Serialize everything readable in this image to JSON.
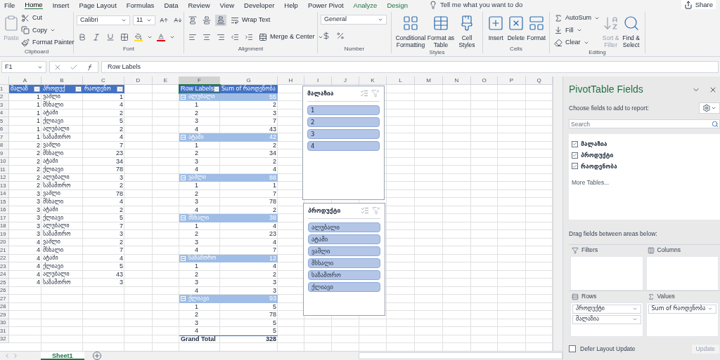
{
  "menu_tabs": [
    {
      "label": "File",
      "selected": false,
      "contextual": false
    },
    {
      "label": "Home",
      "selected": true,
      "contextual": false
    },
    {
      "label": "Insert",
      "selected": false,
      "contextual": false
    },
    {
      "label": "Page Layout",
      "selected": false,
      "contextual": false
    },
    {
      "label": "Formulas",
      "selected": false,
      "contextual": false
    },
    {
      "label": "Data",
      "selected": false,
      "contextual": false
    },
    {
      "label": "Review",
      "selected": false,
      "contextual": false
    },
    {
      "label": "View",
      "selected": false,
      "contextual": false
    },
    {
      "label": "Developer",
      "selected": false,
      "contextual": false
    },
    {
      "label": "Help",
      "selected": false,
      "contextual": false
    },
    {
      "label": "Power Pivot",
      "selected": false,
      "contextual": false
    },
    {
      "label": "Analyze",
      "selected": false,
      "contextual": true
    },
    {
      "label": "Design",
      "selected": false,
      "contextual": true
    }
  ],
  "tell_me": "Tell me what you want to do",
  "share": "Share",
  "ribbon": {
    "clipboard": {
      "label": "Clipboard",
      "paste": {
        "label": "Paste",
        "disabled": true
      },
      "cut": "Cut",
      "copy": "Copy",
      "format_painter": "Format Painter"
    },
    "font": {
      "label": "Font",
      "font_name": "Calibri",
      "font_size": "11"
    },
    "alignment": {
      "label": "Alignment",
      "wrap_text": "Wrap Text",
      "merge_center": "Merge & Center"
    },
    "number": {
      "label": "Number",
      "format": "General"
    },
    "styles": {
      "label": "Styles",
      "buttons": [
        "Conditional Formatting",
        "Format as Table",
        "Cell Styles"
      ]
    },
    "cells": {
      "label": "Cells",
      "buttons": [
        "Insert",
        "Delete",
        "Format"
      ]
    },
    "editing": {
      "label": "Editing",
      "autosum": "AutoSum",
      "fill": "Fill",
      "clear": "Clear",
      "sort_filter": {
        "label": "Sort & Filter",
        "disabled": true
      },
      "find_select": "Find & Select"
    }
  },
  "formula_bar": {
    "name_box": "F1",
    "content": "Row Labels"
  },
  "columns": [
    "A",
    "B",
    "C",
    "D",
    "E",
    "F",
    "G",
    "H",
    "I",
    "J",
    "K",
    "L",
    "M",
    "N",
    "O",
    "P",
    "Q"
  ],
  "row_numbers": [
    "1",
    "2",
    "3",
    "4",
    "5",
    "6",
    "7",
    "8",
    "9",
    "10",
    "11",
    "12",
    "13",
    "14",
    "15",
    "16",
    "17",
    "18",
    "19",
    "20",
    "21",
    "22",
    "23",
    "24",
    "25",
    "26",
    "27",
    "28",
    "29",
    "30",
    "31",
    "32"
  ],
  "source_table": {
    "headers": [
      "მალაზ",
      "პროდუქ",
      "რაოდენო"
    ],
    "rows": [
      [
        "1",
        "ვაშლი",
        "1"
      ],
      [
        "1",
        "მსხალი",
        "4"
      ],
      [
        "1",
        "ატამი",
        "2"
      ],
      [
        "1",
        "ქლიავი",
        "5"
      ],
      [
        "1",
        "ალუბალი",
        "2"
      ],
      [
        "1",
        "საზამთრო",
        "4"
      ],
      [
        "2",
        "ვაშლი",
        "7"
      ],
      [
        "2",
        "მსხალი",
        "23"
      ],
      [
        "2",
        "ატამი",
        "34"
      ],
      [
        "2",
        "ქლიავი",
        "78"
      ],
      [
        "2",
        "ალუბალი",
        "3"
      ],
      [
        "2",
        "საზამთრო",
        "2"
      ],
      [
        "3",
        "ვაშლი",
        "78"
      ],
      [
        "3",
        "მსხალი",
        "4"
      ],
      [
        "3",
        "ატამი",
        "2"
      ],
      [
        "3",
        "ქლიავი",
        "5"
      ],
      [
        "3",
        "ალუბალი",
        "7"
      ],
      [
        "3",
        "საზამთრო",
        "3"
      ],
      [
        "4",
        "ვაშლი",
        "2"
      ],
      [
        "4",
        "მსხალი",
        "7"
      ],
      [
        "4",
        "ატამი",
        "4"
      ],
      [
        "4",
        "ქლიავი",
        "5"
      ],
      [
        "4",
        "ალუბალი",
        "43"
      ],
      [
        "4",
        "საზამთრო",
        "3"
      ]
    ]
  },
  "pivot": {
    "header": {
      "row_label": "Row Labels",
      "value_label": "Sum of რაოდენობა",
      "selected": true
    },
    "groups": [
      {
        "label": "ალუბალი",
        "total": "55",
        "rows": [
          [
            "1",
            "2"
          ],
          [
            "2",
            "3"
          ],
          [
            "3",
            "7"
          ],
          [
            "4",
            "43"
          ]
        ]
      },
      {
        "label": "ატამი",
        "total": "42",
        "rows": [
          [
            "1",
            "2"
          ],
          [
            "2",
            "34"
          ],
          [
            "3",
            "2"
          ],
          [
            "4",
            "4"
          ]
        ]
      },
      {
        "label": "ვაშლი",
        "total": "88",
        "rows": [
          [
            "1",
            "1"
          ],
          [
            "2",
            "7"
          ],
          [
            "3",
            "78"
          ],
          [
            "4",
            "2"
          ]
        ]
      },
      {
        "label": "მსხალი",
        "total": "38",
        "rows": [
          [
            "1",
            "4"
          ],
          [
            "2",
            "23"
          ],
          [
            "3",
            "4"
          ],
          [
            "4",
            "7"
          ]
        ]
      },
      {
        "label": "საზამთრო",
        "total": "12",
        "rows": [
          [
            "1",
            "4"
          ],
          [
            "2",
            "2"
          ],
          [
            "3",
            "3"
          ],
          [
            "4",
            "3"
          ]
        ]
      },
      {
        "label": "ქლიავი",
        "total": "93",
        "rows": [
          [
            "1",
            "5"
          ],
          [
            "2",
            "78"
          ],
          [
            "3",
            "5"
          ],
          [
            "4",
            "5"
          ]
        ]
      }
    ],
    "grand_total": {
      "label": "Grand Total",
      "value": "328"
    }
  },
  "slicers": [
    {
      "title": "მალაზია",
      "items": [
        {
          "label": "1",
          "selected": true
        },
        {
          "label": "2",
          "selected": true
        },
        {
          "label": "3",
          "selected": true
        },
        {
          "label": "4",
          "selected": true
        }
      ]
    },
    {
      "title": "პროდუქტი",
      "items": [
        {
          "label": "ალუბალი",
          "selected": true
        },
        {
          "label": "ატამი",
          "selected": true
        },
        {
          "label": "ვაშლი",
          "selected": true
        },
        {
          "label": "მსხალი",
          "selected": true
        },
        {
          "label": "საზამთრო",
          "selected": true
        },
        {
          "label": "ქლიავი",
          "selected": true
        }
      ]
    }
  ],
  "sheet_tabs": [
    {
      "label": "Sheet1",
      "selected": true
    }
  ],
  "fields_pane": {
    "title": "PivotTable Fields",
    "subtitle": "Choose fields to add to report:",
    "search_placeholder": "Search",
    "fields": [
      {
        "label": "მალაზია",
        "checked": true
      },
      {
        "label": "პროდუქტი",
        "checked": true
      },
      {
        "label": "რაოდენობა",
        "checked": true
      }
    ],
    "more_tables": "More Tables...",
    "drag_hint": "Drag fields between areas below:",
    "areas": {
      "filters": {
        "label": "Filters"
      },
      "columns": {
        "label": "Columns"
      },
      "rows": {
        "label": "Rows",
        "items": [
          "პროდუქტი",
          "მალაზია"
        ]
      },
      "values": {
        "label": "Values",
        "items": [
          "Sum of რაოდენობა"
        ]
      }
    },
    "defer": {
      "label": "Defer Layout Update",
      "checked": false
    },
    "update": {
      "label": "Update",
      "disabled": true
    }
  }
}
